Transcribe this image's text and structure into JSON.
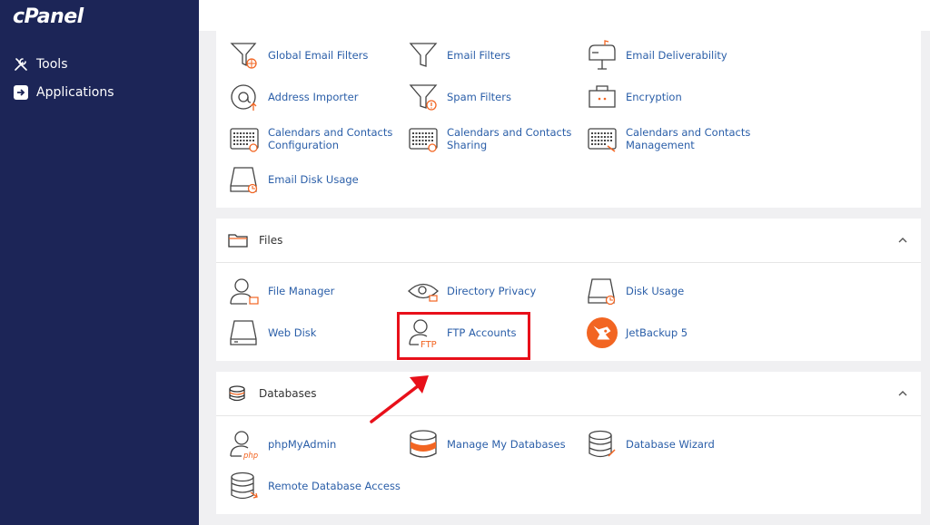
{
  "sidebar": {
    "logo": "cPanel",
    "items": [
      {
        "label": "Tools",
        "icon": "tools-icon"
      },
      {
        "label": "Applications",
        "icon": "applications-icon"
      }
    ]
  },
  "email": {
    "items": [
      {
        "label": "Global Email Filters",
        "icon": "global-filter-icon"
      },
      {
        "label": "Email Filters",
        "icon": "filter-icon"
      },
      {
        "label": "Email Deliverability",
        "icon": "mailbox-icon"
      },
      {
        "label": "Address Importer",
        "icon": "at-upload-icon"
      },
      {
        "label": "Spam Filters",
        "icon": "spam-filter-icon"
      },
      {
        "label": "Encryption",
        "icon": "encryption-icon"
      },
      {
        "label": "Calendars and Contacts\nConfiguration",
        "icon": "calendar-config-icon"
      },
      {
        "label": "Calendars and Contacts\nSharing",
        "icon": "calendar-share-icon"
      },
      {
        "label": "Calendars and Contacts\nManagement",
        "icon": "calendar-manage-icon"
      },
      {
        "label": "Email Disk Usage",
        "icon": "disk-usage-icon"
      }
    ]
  },
  "files": {
    "title": "Files",
    "items": [
      {
        "label": "File Manager",
        "icon": "file-manager-icon"
      },
      {
        "label": "Directory Privacy",
        "icon": "directory-privacy-icon"
      },
      {
        "label": "Disk Usage",
        "icon": "disk-usage-icon"
      },
      {
        "label": "Web Disk",
        "icon": "web-disk-icon"
      },
      {
        "label": "FTP Accounts",
        "icon": "ftp-accounts-icon"
      },
      {
        "label": "JetBackup 5",
        "icon": "jetbackup-icon"
      }
    ]
  },
  "databases": {
    "title": "Databases",
    "items": [
      {
        "label": "phpMyAdmin",
        "icon": "phpmyadmin-icon"
      },
      {
        "label": "Manage My Databases",
        "icon": "manage-databases-icon"
      },
      {
        "label": "Database Wizard",
        "icon": "database-wizard-icon"
      },
      {
        "label": "Remote Database Access",
        "icon": "remote-database-icon"
      }
    ]
  },
  "colors": {
    "sidebar": "#1c2557",
    "link": "#2a5ea8",
    "accent": "#f26522",
    "highlight": "#e8101a"
  }
}
